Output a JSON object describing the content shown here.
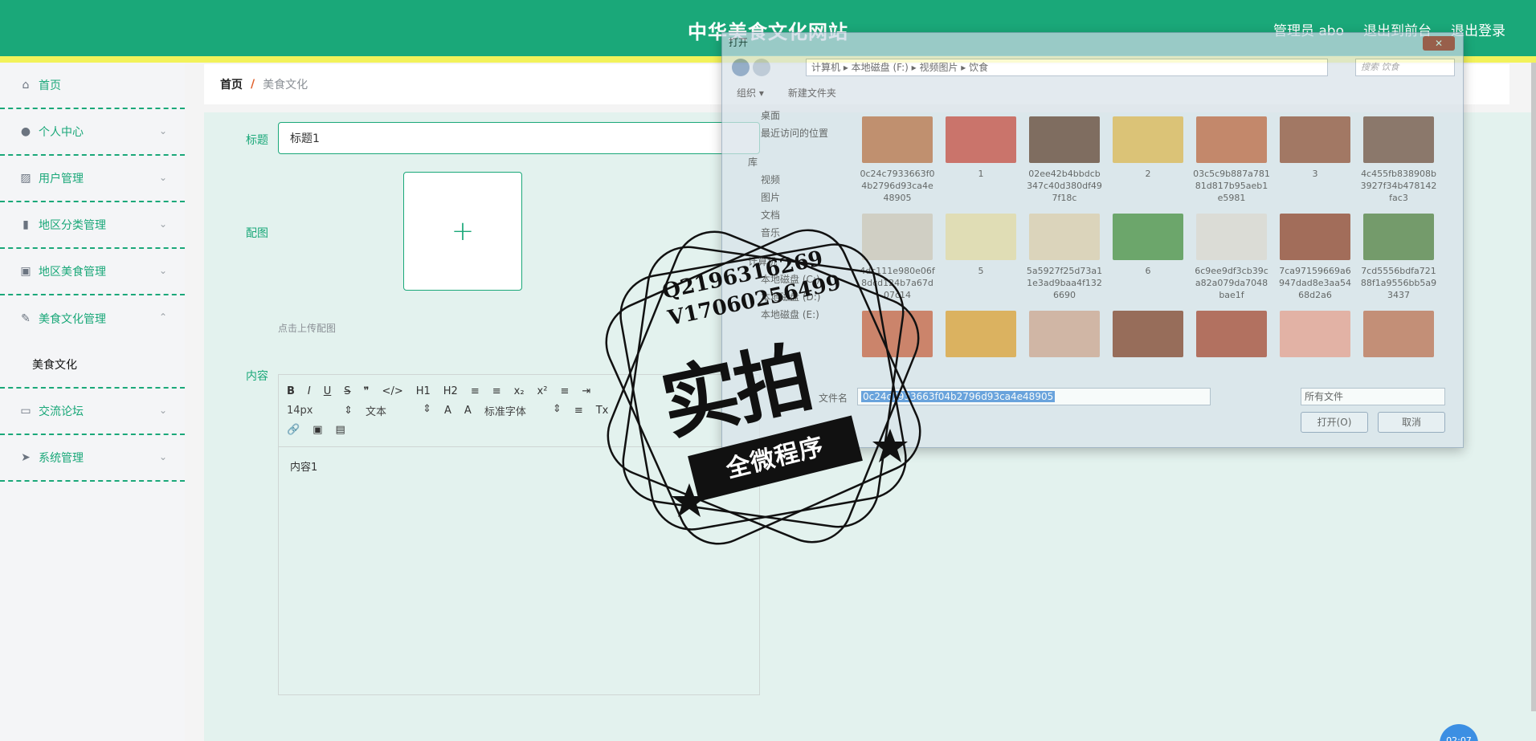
{
  "header": {
    "site_title": "中华美食文化网站",
    "admin_label": "管理员 abo",
    "front_label": "退出到前台",
    "logout_label": "退出登录"
  },
  "sidebar": {
    "items": [
      {
        "label": "首页",
        "icon": "home-icon"
      },
      {
        "label": "个人中心",
        "icon": "user-icon"
      },
      {
        "label": "用户管理",
        "icon": "chart-icon"
      },
      {
        "label": "地区分类管理",
        "icon": "bar-chart-icon"
      },
      {
        "label": "地区美食管理",
        "icon": "clipboard-icon"
      },
      {
        "label": "美食文化管理",
        "icon": "edit-icon"
      },
      {
        "label": "美食文化",
        "icon": ""
      },
      {
        "label": "交流论坛",
        "icon": "monitor-icon"
      },
      {
        "label": "系统管理",
        "icon": "send-icon"
      }
    ]
  },
  "breadcrumb": {
    "home": "首页",
    "separator": "/",
    "current": "美食文化"
  },
  "form": {
    "title_label": "标题",
    "title_value": "标题1",
    "image_label": "配图",
    "upload_plus": "+",
    "upload_hint": "点击上传配图",
    "content_label": "内容",
    "content_value": "内容1"
  },
  "editor": {
    "row1": [
      "B",
      "I",
      "U",
      "S",
      "❞",
      "</>",
      "H1",
      "H2",
      "≡",
      "≡",
      "x₂",
      "x²",
      "≡",
      "⇥"
    ],
    "font_size": "14px",
    "text_style": "文本",
    "font_family": "标准字体",
    "row2_icons": [
      "A",
      "A",
      "≡",
      "Tx"
    ],
    "row3": [
      "🔗",
      "▣",
      "▤"
    ]
  },
  "dialog": {
    "title": "打开",
    "close": "✕",
    "path": "计算机 ▸ 本地磁盘 (F:) ▸ 视频图片 ▸ 饮食",
    "search_placeholder": "搜索 饮食",
    "organize": "组织 ▾",
    "new_folder": "新建文件夹",
    "left": [
      "桌面",
      "最近访问的位置",
      "库",
      "视频",
      "图片",
      "文档",
      "音乐",
      "计算机",
      "本地磁盘 (C:)",
      "本地磁盘 (D:)",
      "本地磁盘 (E:)"
    ],
    "files": [
      {
        "name": "0c24c7933663f04b2796d93ca4e48905",
        "color": "#b36b3f"
      },
      {
        "name": "1",
        "color": "#c1453a"
      },
      {
        "name": "02ee42b4bbdcb347c40d380df497f18c",
        "color": "#5a3a2a"
      },
      {
        "name": "2",
        "color": "#d8b24a"
      },
      {
        "name": "03c5c9b887a78181d817b95aeb1e5981",
        "color": "#b8603a"
      },
      {
        "name": "3",
        "color": "#8a4a30"
      },
      {
        "name": "4c455fb838908b3927f34b478142fac3",
        "color": "#6a4a3a"
      },
      {
        "name": "4dc111e980e06f8dcd124b7a67d07c14",
        "color": "#c9c2b4"
      },
      {
        "name": "5",
        "color": "#e0d6a0"
      },
      {
        "name": "5a5927f25d73a11e3ad9baa4f1326690",
        "color": "#d8c9a8"
      },
      {
        "name": "6",
        "color": "#3f8a3a"
      },
      {
        "name": "6c9ee9df3cb39ca82a079da7048bae1f",
        "color": "#d8d4ce"
      },
      {
        "name": "7ca97159669a6947dad8e3aa5468d2a6",
        "color": "#8a3a22"
      },
      {
        "name": "7cd5556bdfa72188f1a9556bb5a93437",
        "color": "#4a7a3a"
      },
      {
        "name": "",
        "color": "#c25a3a"
      },
      {
        "name": "",
        "color": "#d89a2a"
      },
      {
        "name": "",
        "color": "#c9a08a"
      },
      {
        "name": "",
        "color": "#7a3a22"
      },
      {
        "name": "",
        "color": "#a0402a"
      },
      {
        "name": "",
        "color": "#e29a8a"
      },
      {
        "name": "",
        "color": "#b86a4a"
      }
    ],
    "filename_label": "文件名",
    "filename_value": "0c24c7933663f04b2796d93ca4e48905",
    "filetype": "所有文件",
    "open_btn": "打开(O)",
    "cancel_btn": "取消"
  },
  "stamp": {
    "line1": "Q2196316269",
    "line2": "V17060256499",
    "big": "实拍",
    "ribbon": "全微程序"
  },
  "fab": "02:07",
  "colors": {
    "primary": "#1aa879",
    "accent": "#f2f25a",
    "content_bg": "#e3f2ee"
  }
}
